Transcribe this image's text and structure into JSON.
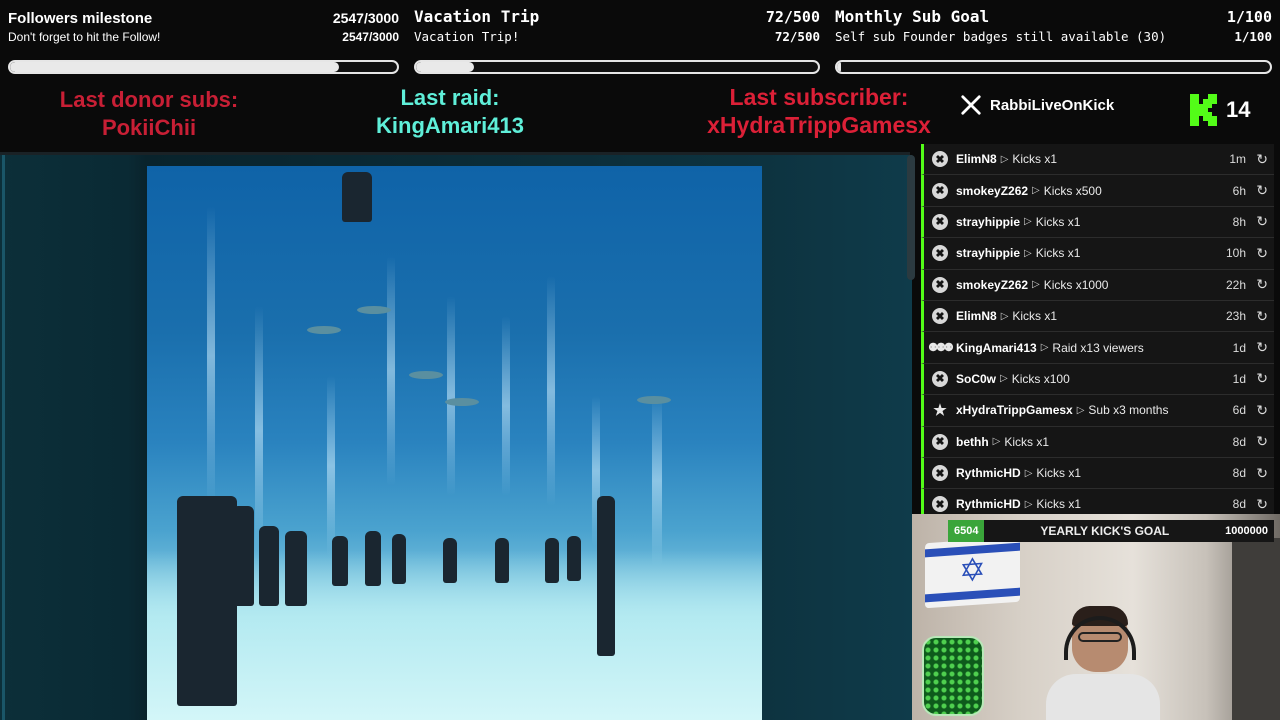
{
  "goals": [
    {
      "title": "Followers milestone",
      "count": "2547/3000",
      "subtitle": "Don't forget to hit the Follow!",
      "subcount": "2547/3000",
      "progress": 0.849
    },
    {
      "title": "Vacation Trip",
      "count": "72/500",
      "subtitle": "Vacation Trip!",
      "subcount": "72/500",
      "progress": 0.144
    },
    {
      "title": "Monthly Sub Goal",
      "count": "1/100",
      "subtitle": "Self sub Founder badges still available (30)",
      "subcount": "1/100",
      "progress": 0.01
    }
  ],
  "alerts": {
    "donor_label": "Last donor subs:",
    "donor_name": "PokiiChii",
    "raid_label": "Last raid:",
    "raid_name": "KingAmari413",
    "sub_label": "Last subscriber:",
    "sub_name": "xHydraTrippGamesx"
  },
  "social": {
    "x_handle": "RabbiLiveOnKick",
    "viewer_count": "14"
  },
  "feed": [
    {
      "icon": "kick-icon",
      "user": "ElimN8",
      "action": "Kicks x1",
      "time": "1m"
    },
    {
      "icon": "kick-icon",
      "user": "smokeyZ262",
      "action": "Kicks x500",
      "time": "6h"
    },
    {
      "icon": "kick-icon",
      "user": "strayhippie",
      "action": "Kicks x1",
      "time": "8h"
    },
    {
      "icon": "kick-icon",
      "user": "strayhippie",
      "action": "Kicks x1",
      "time": "10h"
    },
    {
      "icon": "kick-icon",
      "user": "smokeyZ262",
      "action": "Kicks x1000",
      "time": "22h"
    },
    {
      "icon": "kick-icon",
      "user": "ElimN8",
      "action": "Kicks x1",
      "time": "23h"
    },
    {
      "icon": "raid-icon",
      "user": "KingAmari413",
      "action": "Raid x13 viewers",
      "time": "1d"
    },
    {
      "icon": "kick-icon",
      "user": "SoC0w",
      "action": "Kicks x100",
      "time": "1d"
    },
    {
      "icon": "star-icon",
      "user": "xHydraTrippGamesx",
      "action": "Sub x3 months",
      "time": "6d"
    },
    {
      "icon": "kick-icon",
      "user": "bethh",
      "action": "Kicks x1",
      "time": "8d"
    },
    {
      "icon": "kick-icon",
      "user": "RythmicHD",
      "action": "Kicks x1",
      "time": "8d"
    },
    {
      "icon": "kick-icon",
      "user": "RythmicHD",
      "action": "Kicks x1",
      "time": "8d"
    }
  ],
  "kick_goal": {
    "current": "6504",
    "label": "YEARLY KICK'S GOAL",
    "target": "1000000"
  },
  "colors": {
    "kick_green": "#53fc18",
    "donor_red": "#c81f35",
    "raid_teal": "#5fefd9",
    "sub_red": "#dc2037"
  }
}
